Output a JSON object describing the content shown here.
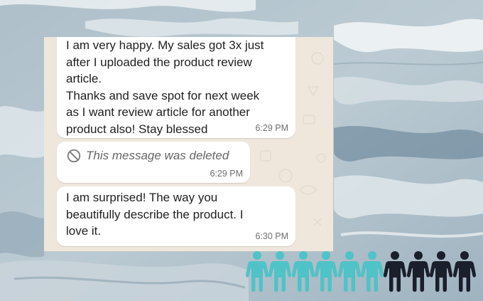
{
  "chat": {
    "messages": [
      {
        "text": "I am very happy. My sales got 3x just\nafter I uploaded the product review\narticle.\nThanks and save spot for next week\nas I want review article for another\nproduct also! Stay blessed",
        "time": "6:29 PM"
      },
      {
        "deleted_text": "This message was deleted",
        "deleted_icon": "ban-icon",
        "time": "6:29 PM"
      },
      {
        "text": "I am surprised! The way you\nbeautifully describe the product. I\nlove it.",
        "time": "6:30 PM"
      }
    ]
  },
  "people_icons": {
    "icon": "person-icon",
    "count_highlighted": 6,
    "count_total": 10,
    "highlight_color": "#4fc3c7",
    "base_color": "#1b1e2b"
  },
  "colors": {
    "chat_background": "#efe7dc",
    "bubble": "#ffffff",
    "text": "#1f1f1f",
    "timestamp": "#6e6e6e"
  }
}
